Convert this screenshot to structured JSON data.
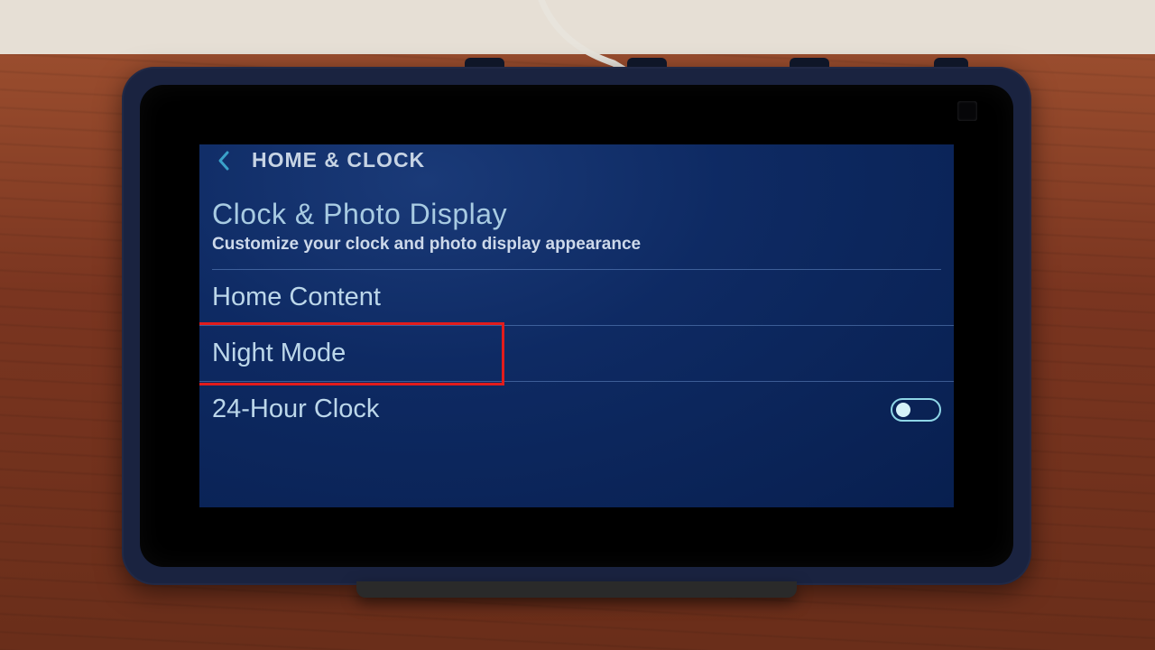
{
  "header": {
    "title": "HOME & CLOCK"
  },
  "section": {
    "title": "Clock & Photo Display",
    "subtitle": "Customize your clock and photo display appearance"
  },
  "items": [
    {
      "label": "Home Content"
    },
    {
      "label": "Night Mode"
    },
    {
      "label": "24-Hour Clock",
      "toggle": false
    }
  ],
  "highlight_index": 1
}
